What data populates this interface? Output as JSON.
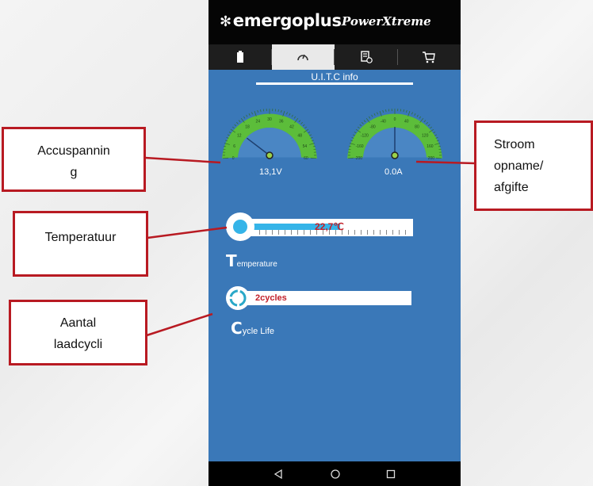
{
  "app": {
    "brand": "emergoplus",
    "brand2": "PowerXtreme"
  },
  "tabs": [
    {
      "icon": "battery-icon",
      "selected": false
    },
    {
      "icon": "speedometer-icon",
      "selected": true
    },
    {
      "icon": "document-info-icon",
      "selected": false
    },
    {
      "icon": "cart-icon",
      "selected": false
    }
  ],
  "section_title": "U.I.T.C info",
  "voltage_gauge": {
    "ticks": [
      "0",
      "6",
      "12",
      "18",
      "24",
      "30",
      "36",
      "42",
      "48",
      "54",
      "60"
    ],
    "value": "13,1V"
  },
  "current_gauge": {
    "ticks": [
      "-200",
      "-160",
      "-120",
      "-80",
      "-40",
      "0",
      "40",
      "80",
      "120",
      "160",
      "200"
    ],
    "value": "0.0A"
  },
  "temperature": {
    "value": "22,7℃",
    "label_initial": "T",
    "label_rest": "emperature"
  },
  "cycles": {
    "value": "2cycles",
    "label_initial": "C",
    "label_rest": "ycle Life"
  },
  "callouts": {
    "voltage": [
      "Accuspannin",
      "g"
    ],
    "current": [
      "Stroom",
      "opname/",
      "afgifte"
    ],
    "temperature": [
      "Temperatuur"
    ],
    "cycles": [
      "Aantal",
      "laadcycli"
    ]
  },
  "colors": {
    "app_bg": "#3a78b8",
    "gauge_green": "#5cbd3a",
    "accent_red": "#c2202a",
    "callout_border": "#b81a22"
  }
}
